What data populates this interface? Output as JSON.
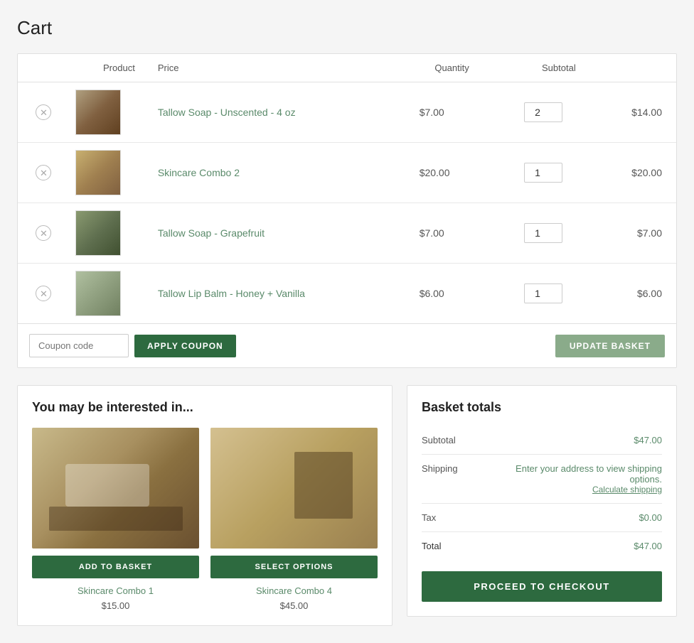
{
  "page": {
    "title": "Cart"
  },
  "cart": {
    "table": {
      "headers": {
        "product": "Product",
        "price": "Price",
        "quantity": "Quantity",
        "subtotal": "Subtotal"
      },
      "items": [
        {
          "id": "item-1",
          "product_name": "Tallow Soap - Unscented - 4 oz",
          "price": "$7.00",
          "quantity": "2",
          "subtotal": "$14.00"
        },
        {
          "id": "item-2",
          "product_name": "Skincare Combo 2",
          "price": "$20.00",
          "quantity": "1",
          "subtotal": "$20.00"
        },
        {
          "id": "item-3",
          "product_name": "Tallow Soap - Grapefruit",
          "price": "$7.00",
          "quantity": "1",
          "subtotal": "$7.00"
        },
        {
          "id": "item-4",
          "product_name": "Tallow Lip Balm - Honey + Vanilla",
          "price": "$6.00",
          "quantity": "1",
          "subtotal": "$6.00"
        }
      ]
    },
    "coupon_placeholder": "Coupon code",
    "apply_coupon_label": "APPLY COUPON",
    "update_basket_label": "UPDATE BASKET"
  },
  "interested": {
    "title": "You may be interested in...",
    "products": [
      {
        "name": "Skincare Combo 1",
        "price": "$15.00",
        "button_label": "ADD TO BASKET"
      },
      {
        "name": "Skincare Combo 4",
        "price": "$45.00",
        "button_label": "SELECT OPTIONS"
      }
    ]
  },
  "totals": {
    "title": "Basket totals",
    "subtotal_label": "Subtotal",
    "subtotal_value": "$47.00",
    "shipping_label": "Shipping",
    "shipping_note": "Enter your address to view shipping options.",
    "shipping_calc": "Calculate shipping",
    "tax_label": "Tax",
    "tax_value": "$0.00",
    "total_label": "Total",
    "total_value": "$47.00",
    "checkout_label": "PROCEED TO CHECKOUT"
  }
}
